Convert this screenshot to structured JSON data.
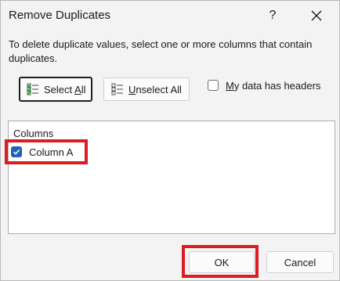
{
  "dialog": {
    "title": "Remove Duplicates",
    "help_label": "?",
    "instruction": "To delete duplicate values, select one or more columns that contain duplicates."
  },
  "buttons": {
    "select_all_pre": "Select ",
    "select_all_ul": "A",
    "select_all_post": "ll",
    "unselect_all_ul": "U",
    "unselect_all_post": "nselect All",
    "ok_label": "OK",
    "cancel_label": "Cancel"
  },
  "headers_checkbox": {
    "label_ul": "M",
    "label_post": "y data has headers",
    "checked": false
  },
  "columns": {
    "header": "Columns",
    "items": [
      {
        "label": "Column A",
        "checked": true
      }
    ]
  },
  "colors": {
    "accent": "#1e63b5",
    "highlight": "#dc1c23"
  }
}
